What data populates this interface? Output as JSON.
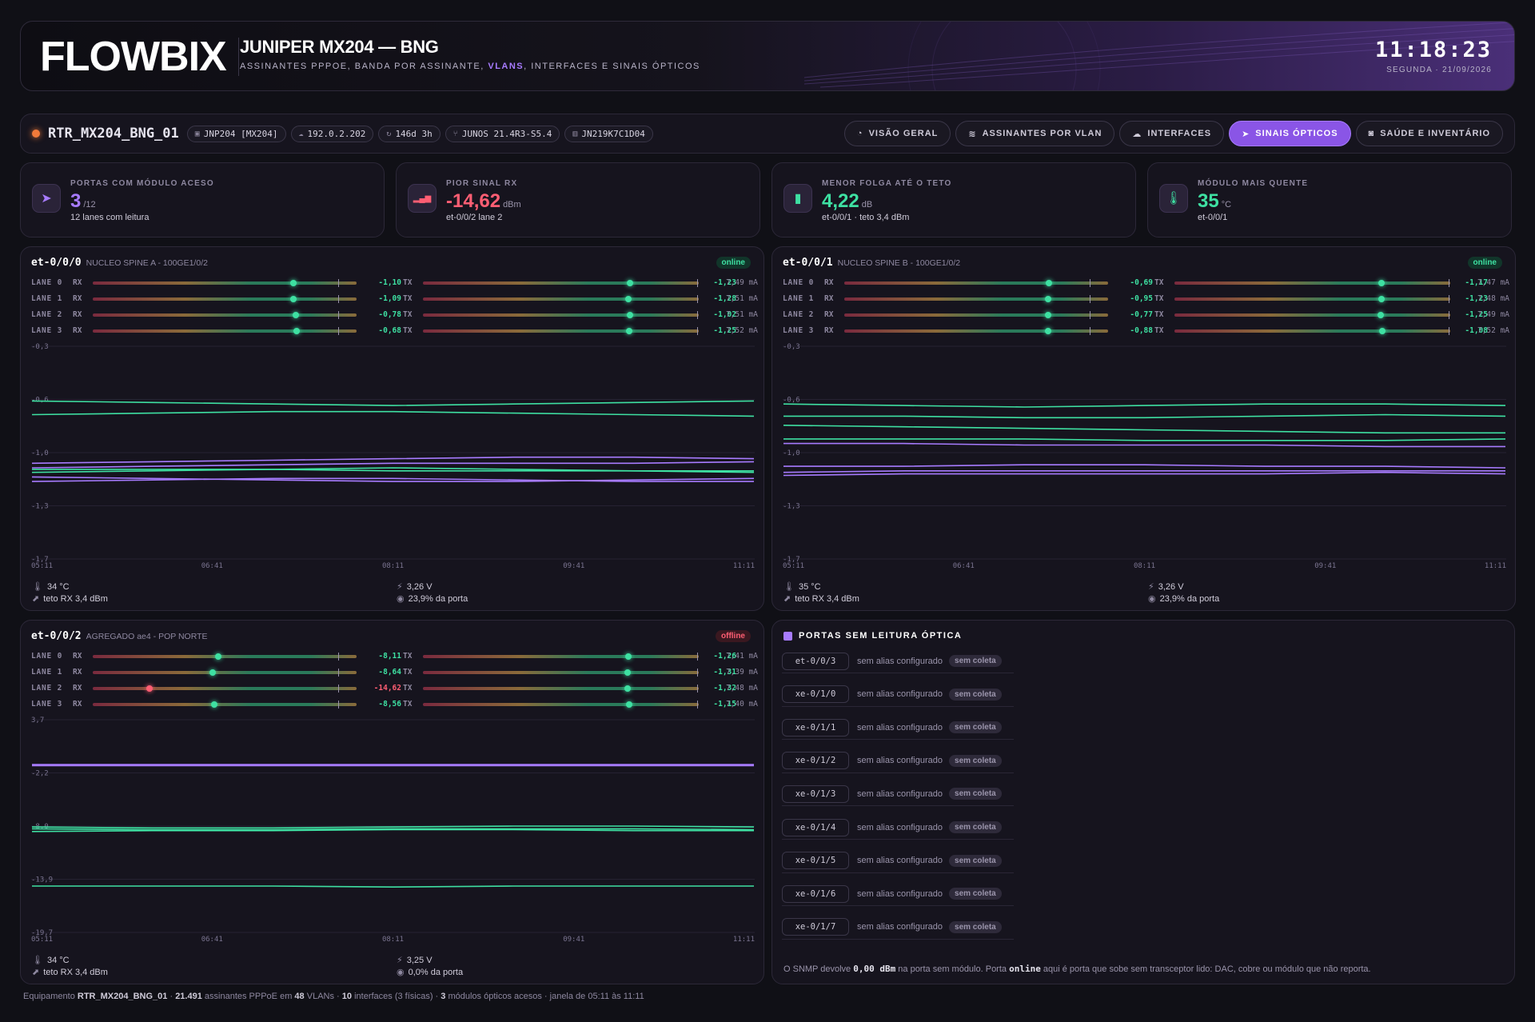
{
  "header": {
    "logo": "FLOWBIX",
    "title": "JUNIPER MX204 — BNG",
    "subtitle_pre": "ASSINANTES PPPOE, BANDA POR ASSINANTE,",
    "subtitle_hl": "VLANS",
    "subtitle_post": ", INTERFACES E SINAIS ÓPTICOS",
    "clock": "11:18:23",
    "date": "SEGUNDA · 21/09/2026"
  },
  "router": {
    "name": "RTR_MX204_BNG_01",
    "chips": [
      {
        "icon": "cpu-icon",
        "glyph": "▣",
        "text": "JNP204 [MX204]"
      },
      {
        "icon": "cloud-icon",
        "glyph": "☁",
        "text": "192.0.2.202"
      },
      {
        "icon": "uptime-icon",
        "glyph": "↻",
        "text": "146d 3h"
      },
      {
        "icon": "branch-icon",
        "glyph": "⑂",
        "text": "JUNOS 21.4R3-S5.4"
      },
      {
        "icon": "barcode-icon",
        "glyph": "▥",
        "text": "JN219K7C1D04"
      }
    ]
  },
  "tabs": [
    {
      "label": "VISÃO GERAL",
      "icon": "gauge-icon",
      "glyph": "◔",
      "active": false
    },
    {
      "label": "ASSINANTES POR VLAN",
      "icon": "layers-icon",
      "glyph": "≋",
      "active": false
    },
    {
      "label": "INTERFACES",
      "icon": "cloud-icon",
      "glyph": "☁",
      "active": false
    },
    {
      "label": "SINAIS ÓPTICOS",
      "icon": "send-icon",
      "glyph": "➤",
      "active": true
    },
    {
      "label": "SAÚDE E INVENTÁRIO",
      "icon": "chip-icon",
      "glyph": "◙",
      "active": false
    }
  ],
  "stats": [
    {
      "icon": "send-icon",
      "glyph": "➤",
      "label": "PORTAS COM MÓDULO ACESO",
      "value": "3",
      "unit": "/12",
      "sub": "12 lanes com leitura",
      "color": "#a77bff"
    },
    {
      "icon": "signal-icon",
      "glyph": "▂▄▆",
      "label": "PIOR SINAL RX",
      "value": "-14,62",
      "unit": "dBm",
      "sub": "et-0/0/2 lane 2",
      "color": "#ff5e73"
    },
    {
      "icon": "battery-icon",
      "glyph": "▮",
      "label": "MENOR FOLGA ATÉ O TETO",
      "value": "4,22",
      "unit": "dB",
      "sub": "et-0/0/1 · teto 3,4 dBm",
      "color": "#3ee0a2"
    },
    {
      "icon": "thermometer-icon",
      "glyph": "🌡",
      "label": "MÓDULO MAIS QUENTE",
      "value": "35",
      "unit": "°C",
      "sub": "et-0/0/1",
      "color": "#3ee0a2"
    }
  ],
  "ports": [
    {
      "id": "et-0/0/0",
      "alias": "NUCLEO SPINE A - 100GE1/0/2",
      "status": "online",
      "lanes": [
        {
          "name": "LANE 0",
          "rx": "-1,10",
          "tx": "-1,23",
          "ma": "7,49 mA",
          "rxp": 0.76,
          "txp": 0.75,
          "warn": false
        },
        {
          "name": "LANE 1",
          "rx": "-1,09",
          "tx": "-1,28",
          "ma": "7,51 mA",
          "rxp": 0.76,
          "txp": 0.745,
          "warn": false
        },
        {
          "name": "LANE 2",
          "rx": "-0,78",
          "tx": "-1,02",
          "ma": "7,51 mA",
          "rxp": 0.77,
          "txp": 0.752,
          "warn": false
        },
        {
          "name": "LANE 3",
          "rx": "-0,68",
          "tx": "-1,25",
          "ma": "7,52 mA",
          "rxp": 0.773,
          "txp": 0.748,
          "warn": false
        }
      ],
      "chart": {
        "yticks": [
          "-0,3",
          "-0,6",
          "-1,0",
          "-1,3",
          "-1,7"
        ],
        "ymax": -0.3,
        "ymin": -1.7,
        "xticks": [
          "05:11",
          "06:41",
          "08:11",
          "09:41",
          "11:11"
        ],
        "series": [
          {
            "color": "#3ee0a2",
            "values": [
              -0.66,
              -0.67,
              -0.68,
              -0.69,
              -0.68,
              -0.67,
              -0.66
            ]
          },
          {
            "color": "#3ee0a2",
            "values": [
              -0.75,
              -0.74,
              -0.73,
              -0.73,
              -0.74,
              -0.75,
              -0.76
            ]
          },
          {
            "color": "#3ee0a2",
            "values": [
              -1.13,
              -1.12,
              -1.11,
              -1.1,
              -1.11,
              -1.12,
              -1.13
            ]
          },
          {
            "color": "#3ee0a2",
            "values": [
              -1.11,
              -1.11,
              -1.11,
              -1.12,
              -1.12,
              -1.12,
              -1.12
            ]
          },
          {
            "color": "#a77bff",
            "values": [
              -1.07,
              -1.06,
              -1.05,
              -1.04,
              -1.03,
              -1.03,
              -1.04
            ]
          },
          {
            "color": "#a77bff",
            "values": [
              -1.1,
              -1.09,
              -1.08,
              -1.07,
              -1.07,
              -1.07,
              -1.06
            ]
          },
          {
            "color": "#a77bff",
            "values": [
              -1.16,
              -1.17,
              -1.18,
              -1.19,
              -1.19,
              -1.18,
              -1.17
            ]
          },
          {
            "color": "#a77bff",
            "values": [
              -1.19,
              -1.18,
              -1.17,
              -1.17,
              -1.18,
              -1.19,
              -1.19
            ]
          }
        ]
      },
      "temp": "34 °C",
      "ceiling": "teto RX 3,4 dBm",
      "voltage": "3,26 V",
      "usage": "23,9% da porta"
    },
    {
      "id": "et-0/0/1",
      "alias": "NUCLEO SPINE B - 100GE1/0/2",
      "status": "online",
      "lanes": [
        {
          "name": "LANE 0",
          "rx": "-0,69",
          "tx": "-1,17",
          "ma": "7,47 mA",
          "rxp": 0.775,
          "txp": 0.752,
          "warn": false
        },
        {
          "name": "LANE 1",
          "rx": "-0,95",
          "tx": "-1,23",
          "ma": "7,48 mA",
          "rxp": 0.772,
          "txp": 0.75,
          "warn": false
        },
        {
          "name": "LANE 2",
          "rx": "-0,77",
          "tx": "-1,25",
          "ma": "7,49 mA",
          "rxp": 0.774,
          "txp": 0.748,
          "warn": false
        },
        {
          "name": "LANE 3",
          "rx": "-0,88",
          "tx": "-1,08",
          "ma": "7,52 mA",
          "rxp": 0.773,
          "txp": 0.755,
          "warn": false
        }
      ],
      "chart": {
        "yticks": [
          "-0,3",
          "-0,6",
          "-1,0",
          "-1,3",
          "-1,7"
        ],
        "ymax": -0.3,
        "ymin": -1.7,
        "xticks": [
          "05:11",
          "06:41",
          "08:11",
          "09:41",
          "11:11"
        ],
        "series": [
          {
            "color": "#3ee0a2",
            "values": [
              -0.68,
              -0.69,
              -0.7,
              -0.69,
              -0.68,
              -0.68,
              -0.69
            ]
          },
          {
            "color": "#3ee0a2",
            "values": [
              -0.76,
              -0.76,
              -0.77,
              -0.77,
              -0.76,
              -0.75,
              -0.76
            ]
          },
          {
            "color": "#3ee0a2",
            "values": [
              -0.82,
              -0.83,
              -0.84,
              -0.85,
              -0.86,
              -0.87,
              -0.87
            ]
          },
          {
            "color": "#3ee0a2",
            "values": [
              -0.91,
              -0.91,
              -0.91,
              -0.92,
              -0.92,
              -0.92,
              -0.91
            ]
          },
          {
            "color": "#a77bff",
            "values": [
              -0.94,
              -0.94,
              -0.95,
              -0.95,
              -0.95,
              -0.96,
              -0.96
            ]
          },
          {
            "color": "#a77bff",
            "values": [
              -1.09,
              -1.09,
              -1.08,
              -1.08,
              -1.09,
              -1.09,
              -1.1
            ]
          },
          {
            "color": "#a77bff",
            "values": [
              -1.13,
              -1.12,
              -1.12,
              -1.12,
              -1.12,
              -1.12,
              -1.12
            ]
          },
          {
            "color": "#a77bff",
            "values": [
              -1.15,
              -1.14,
              -1.14,
              -1.14,
              -1.14,
              -1.13,
              -1.14
            ]
          }
        ]
      },
      "temp": "35 °C",
      "ceiling": "teto RX 3,4 dBm",
      "voltage": "3,26 V",
      "usage": "23,9% da porta"
    },
    {
      "id": "et-0/0/2",
      "alias": "AGREGADO ae4 - POP NORTE",
      "status": "offline",
      "lanes": [
        {
          "name": "LANE 0",
          "rx": "-8,11",
          "tx": "-1,26",
          "ma": "7,41 mA",
          "rxp": 0.475,
          "txp": 0.745,
          "warn": false
        },
        {
          "name": "LANE 1",
          "rx": "-8,64",
          "tx": "-1,31",
          "ma": "7,39 mA",
          "rxp": 0.455,
          "txp": 0.743,
          "warn": false
        },
        {
          "name": "LANE 2",
          "rx": "-14,62",
          "tx": "-1,32",
          "ma": "7,48 mA",
          "rxp": 0.215,
          "txp": 0.743,
          "warn": true
        },
        {
          "name": "LANE 3",
          "rx": "-8,56",
          "tx": "-1,15",
          "ma": "7,40 mA",
          "rxp": 0.46,
          "txp": 0.748,
          "warn": false
        }
      ],
      "chart": {
        "yticks": [
          "3,7",
          "-2,2",
          "-8,0",
          "-13,9",
          "-19,7"
        ],
        "ymax": 3.7,
        "ymin": -19.7,
        "xticks": [
          "05:11",
          "06:41",
          "08:11",
          "09:41",
          "11:11"
        ],
        "series": [
          {
            "color": "#a77bff",
            "values": [
              -1.3,
              -1.3,
              -1.3,
              -1.3,
              -1.3,
              -1.3,
              -1.3
            ]
          },
          {
            "color": "#3ee0a2",
            "values": [
              -8.1,
              -8.2,
              -8.2,
              -8.1,
              -8.0,
              -8.0,
              -8.1
            ]
          },
          {
            "color": "#3ee0a2",
            "values": [
              -8.6,
              -8.5,
              -8.5,
              -8.4,
              -8.4,
              -8.5,
              -8.5
            ]
          },
          {
            "color": "#3ee0a2",
            "values": [
              -8.3,
              -8.4,
              -8.4,
              -8.3,
              -8.3,
              -8.3,
              -8.4
            ]
          },
          {
            "color": "#3ee0a2",
            "values": [
              -14.6,
              -14.6,
              -14.6,
              -14.7,
              -14.6,
              -14.6,
              -14.6
            ]
          }
        ]
      },
      "temp": "34 °C",
      "ceiling": "teto RX 3,4 dBm",
      "voltage": "3,25 V",
      "usage": "0,0% da porta"
    }
  ],
  "noreading": {
    "title": "PORTAS SEM LEITURA ÓPTICA",
    "alias": "sem alias configurado",
    "badge": "sem coleta",
    "ports": [
      "et-0/0/3",
      "xe-0/1/0",
      "xe-0/1/1",
      "xe-0/1/2",
      "xe-0/1/3",
      "xe-0/1/4",
      "xe-0/1/5",
      "xe-0/1/6",
      "xe-0/1/7"
    ],
    "note_a": "O SNMP devolve",
    "note_b": "0,00 dBm",
    "note_c": "na porta sem módulo. Porta",
    "note_d": "online",
    "note_e": "aqui é porta que sobe sem transceptor lido: DAC, cobre ou módulo que não reporta."
  },
  "footer": {
    "a": "Equipamento",
    "b": "RTR_MX204_BNG_01",
    "c": "·",
    "d": "21.491",
    "e": "assinantes PPPoE em",
    "f": "48",
    "g": "VLANs ·",
    "h": "10",
    "i": "interfaces (3 físicas) ·",
    "j": "3",
    "k": "módulos ópticos acesos · janela de 05:11 às 11:11"
  },
  "colors": {
    "accent": "#a77bff",
    "ok": "#3ee0a2",
    "bad": "#ff5e73"
  }
}
